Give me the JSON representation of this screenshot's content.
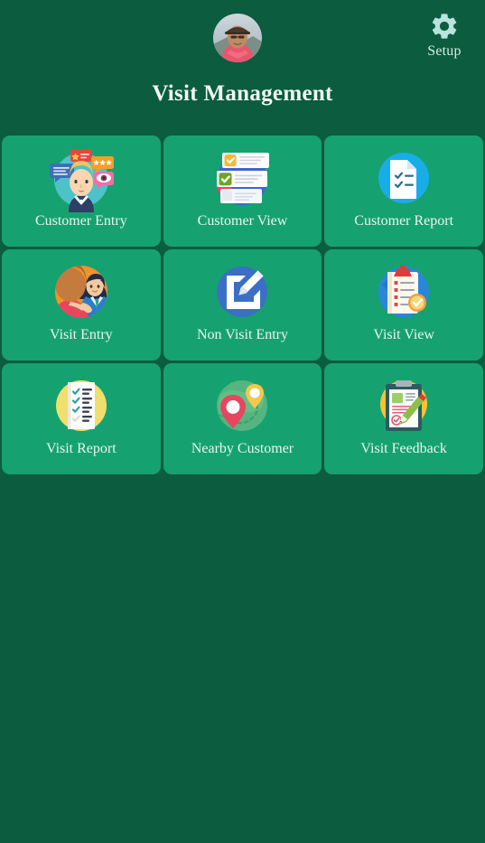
{
  "theme": {
    "background": "#0c5c40",
    "tile_background": "#16a171",
    "title_color": "#f2f9f5",
    "label_color": "#e9f6ef",
    "setup_icon_color": "#b9e3dc"
  },
  "header": {
    "title": "Visit Management",
    "avatar_name": "user-avatar",
    "setup": {
      "label": "Setup",
      "icon": "gear-icon"
    }
  },
  "grid": {
    "tiles": [
      {
        "id": "customer-entry",
        "label": "Customer Entry",
        "icon": "customer-feedback-illustration"
      },
      {
        "id": "customer-view",
        "label": "Customer View",
        "icon": "checklist-cards-illustration"
      },
      {
        "id": "customer-report",
        "label": "Customer Report",
        "icon": "document-checklist-icon"
      },
      {
        "id": "visit-entry",
        "label": "Visit Entry",
        "icon": "two-people-meeting-illustration"
      },
      {
        "id": "non-visit-entry",
        "label": "Non Visit Entry",
        "icon": "edit-square-icon"
      },
      {
        "id": "visit-view",
        "label": "Visit View",
        "icon": "clipboard-check-icon"
      },
      {
        "id": "visit-report",
        "label": "Visit Report",
        "icon": "checklist-document-icon"
      },
      {
        "id": "nearby-customer",
        "label": "Nearby Customer",
        "icon": "map-pins-icon"
      },
      {
        "id": "visit-feedback",
        "label": "Visit Feedback",
        "icon": "clipboard-pencil-icon"
      }
    ]
  }
}
